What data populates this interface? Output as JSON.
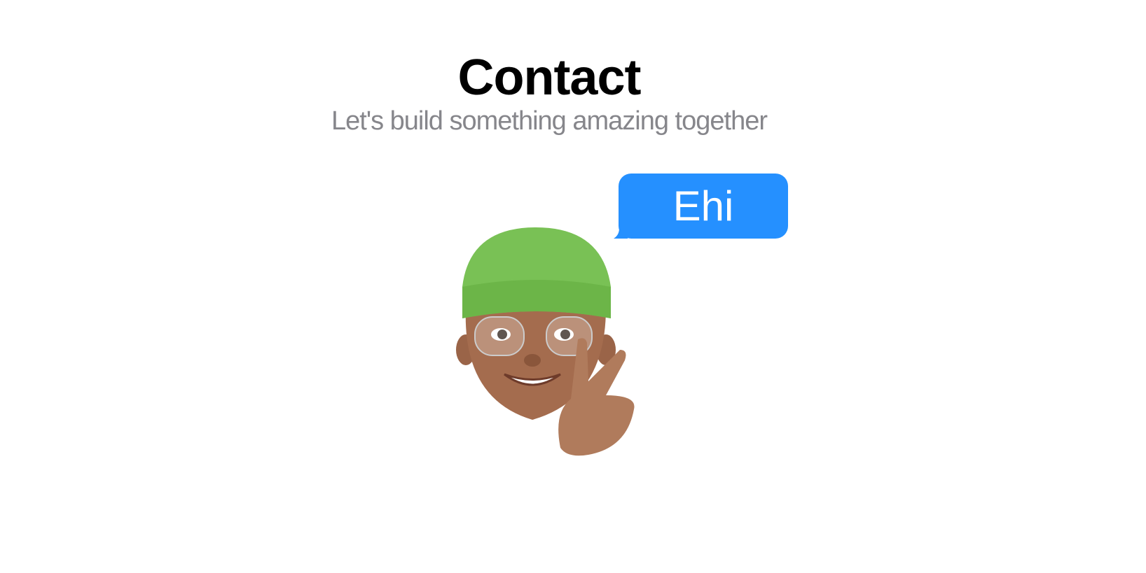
{
  "header": {
    "title": "Contact",
    "subtitle": "Let's build something amazing together"
  },
  "bubble": {
    "text": "Ehi",
    "color": "#2590FF"
  },
  "avatar": {
    "icon": "memoji-peace-sign-icon"
  }
}
